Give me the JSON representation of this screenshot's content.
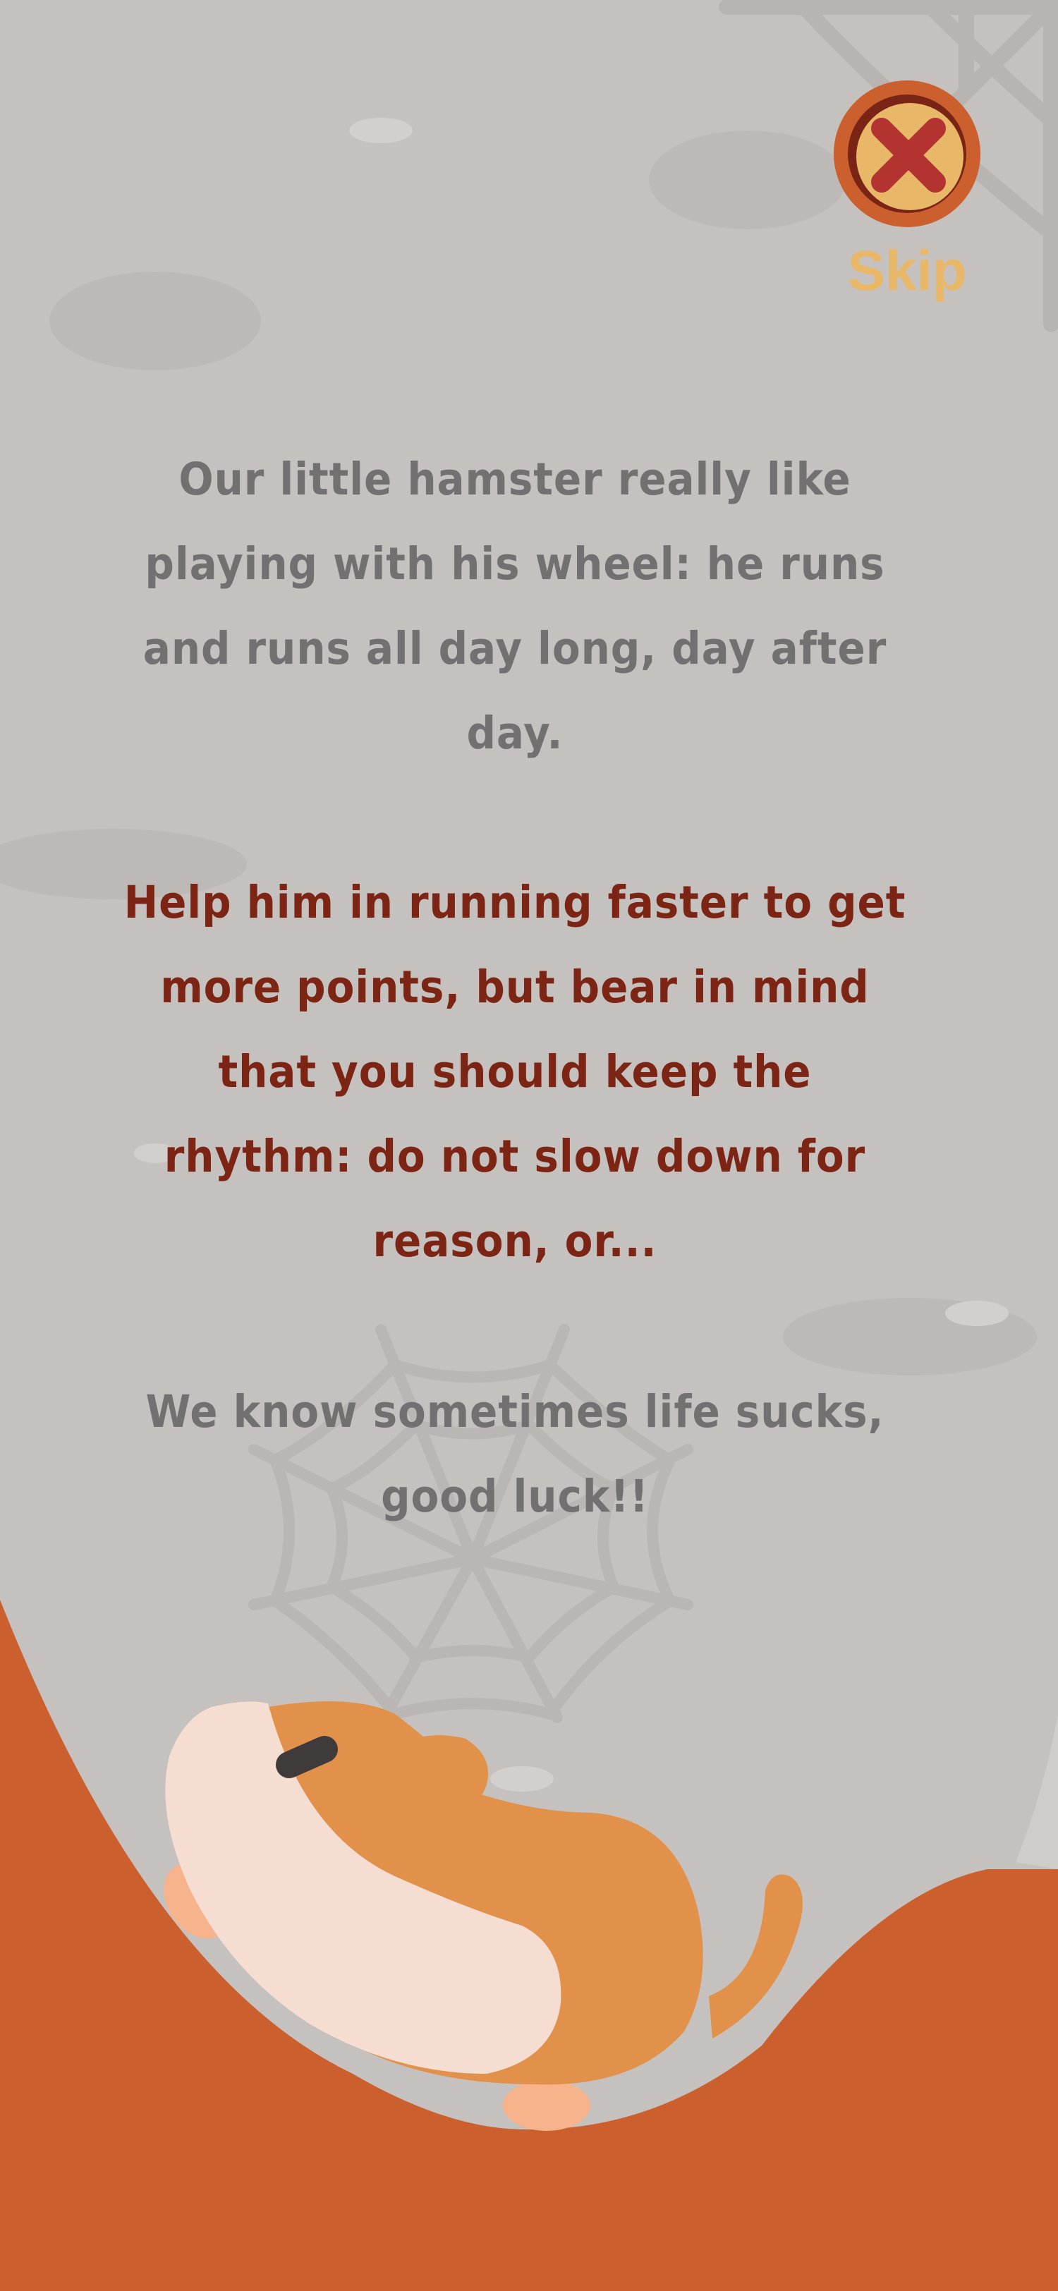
{
  "skip": {
    "label": "Skip",
    "icon": "close-x-icon"
  },
  "intro": {
    "paragraph_1": "Our little hamster really like playing with his wheel: he runs and runs all day long, day after day.",
    "paragraph_2": "Help him in running faster to get more points, but bear in mind that you should keep the rhythm: do not slow down for reason, or...",
    "paragraph_3": "We know sometimes life sucks, good luck!!"
  },
  "colors": {
    "background": "#c5c1bf",
    "body_text": "#727070",
    "highlight_text": "#7c2515",
    "accent_orange": "#cc5f2e",
    "skip_label": "#e9b768",
    "hamster_fur": "#e2914a",
    "hamster_belly": "#f6ddd1"
  },
  "scene": {
    "character": "hamster",
    "decor": [
      "cobweb",
      "spider-web",
      "clouds"
    ]
  }
}
